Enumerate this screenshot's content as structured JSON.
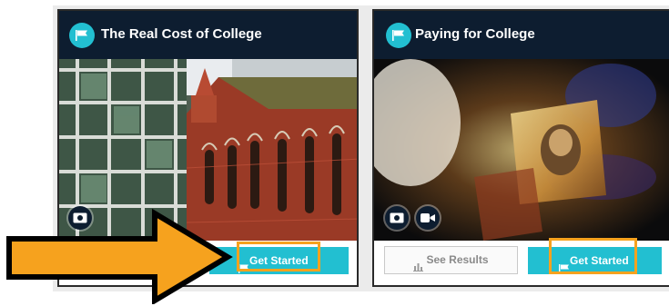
{
  "cards": [
    {
      "title": "The Real Cost of College",
      "get_started_label": "Get Started",
      "media_icons": [
        "money-icon"
      ]
    },
    {
      "title": "Paying for College",
      "get_started_label": "Get Started",
      "see_results_label": "See Results",
      "media_icons": [
        "money-icon",
        "video-camera-icon"
      ]
    }
  ],
  "colors": {
    "header_bg": "#0d1d30",
    "accent": "#22bfd1",
    "highlight": "#f6a21e"
  }
}
